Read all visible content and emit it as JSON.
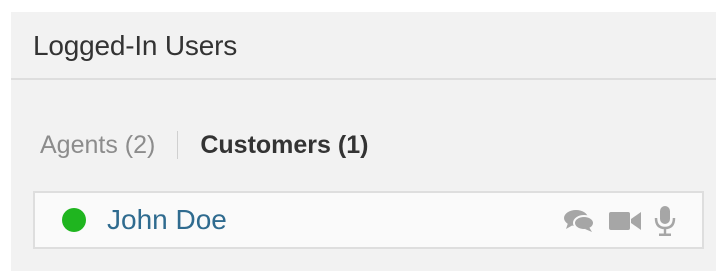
{
  "widget": {
    "title": "Logged-In Users"
  },
  "tabs": [
    {
      "label": "Agents (2)",
      "active": false
    },
    {
      "label": "Customers (1)",
      "active": true
    }
  ],
  "users": [
    {
      "name": "John Doe",
      "status": "online",
      "status_color": "#1fb51f",
      "actions": [
        {
          "icon": "chat-icon"
        },
        {
          "icon": "video-camera-icon"
        },
        {
          "icon": "microphone-icon"
        }
      ]
    }
  ],
  "colors": {
    "link": "#2f6b8f",
    "icon": "#a6a6a6",
    "panel_background": "#f2f2f2"
  }
}
